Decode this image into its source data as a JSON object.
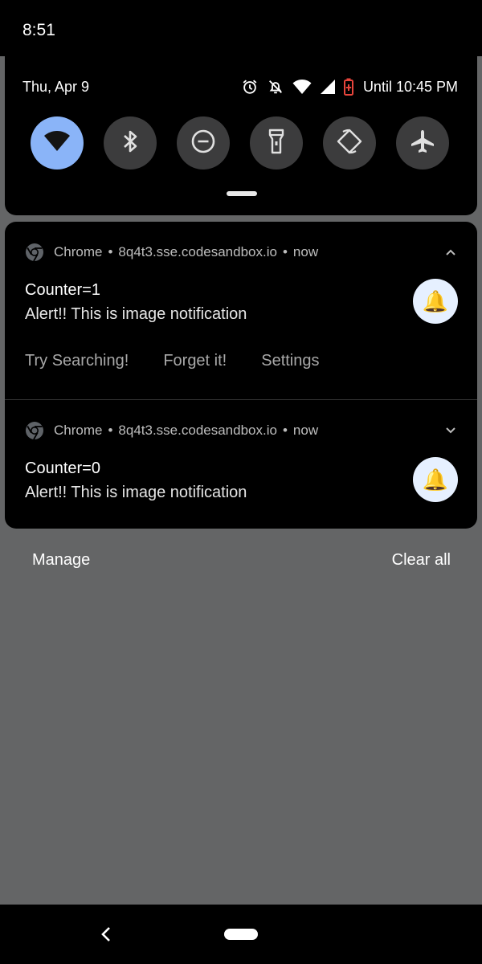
{
  "status_bar": {
    "time": "8:51"
  },
  "quick_settings": {
    "date": "Thu, Apr 9",
    "battery_text": "Until 10:45 PM",
    "tiles": [
      {
        "name": "wifi",
        "icon": "wifi-icon",
        "active": true
      },
      {
        "name": "bluetooth",
        "icon": "bluetooth-icon",
        "active": false
      },
      {
        "name": "do-not-disturb",
        "icon": "dnd-icon",
        "active": false
      },
      {
        "name": "flashlight",
        "icon": "flashlight-icon",
        "active": false
      },
      {
        "name": "auto-rotate",
        "icon": "rotate-icon",
        "active": false
      },
      {
        "name": "airplane-mode",
        "icon": "airplane-icon",
        "active": false
      }
    ],
    "accent_color": "#8ab4f8"
  },
  "notifications": [
    {
      "app": "Chrome",
      "source": "8q4t3.sse.codesandbox.io",
      "time": "now",
      "title": "Counter=1",
      "body": "Alert!! This is image notification",
      "expanded": true,
      "image_icon": "bell-icon",
      "actions": [
        "Try Searching!",
        "Forget it!",
        "Settings"
      ]
    },
    {
      "app": "Chrome",
      "source": "8q4t3.sse.codesandbox.io",
      "time": "now",
      "title": "Counter=0",
      "body": "Alert!! This is image notification",
      "expanded": false,
      "image_icon": "bell-icon"
    }
  ],
  "footer": {
    "manage_label": "Manage",
    "clear_all_label": "Clear all"
  },
  "nav": {
    "back_icon": "back-icon",
    "home_icon": "home-pill-icon"
  }
}
